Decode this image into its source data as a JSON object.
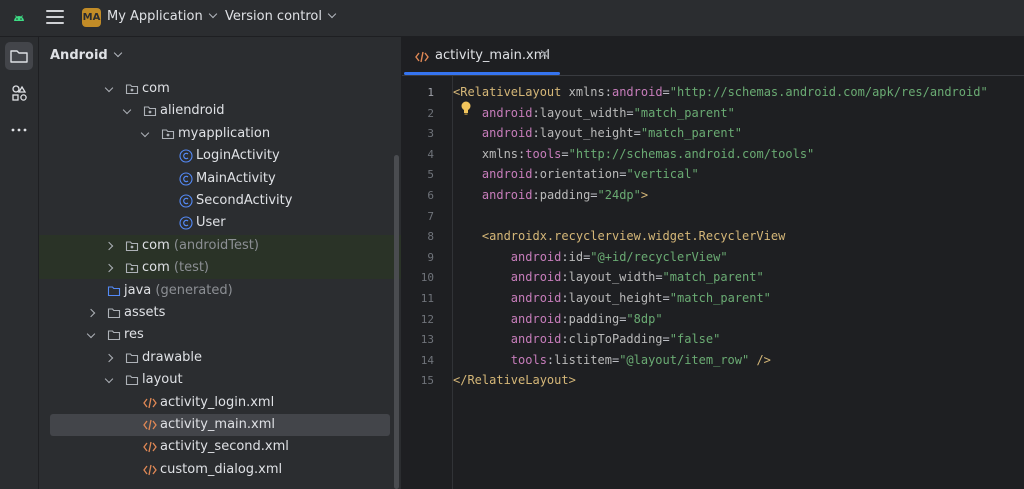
{
  "titlebar": {
    "project_badge": "MA",
    "project_name": "My Application",
    "vcs_label": "Version control"
  },
  "panel": {
    "view_label": "Android"
  },
  "tree": [
    {
      "label": "com",
      "suffix": "",
      "icon": "package-icon",
      "arrow": "down",
      "indent": 1
    },
    {
      "label": "aliendroid",
      "suffix": "",
      "icon": "package-icon",
      "arrow": "down",
      "indent": 2
    },
    {
      "label": "myapplication",
      "suffix": "",
      "icon": "package-icon",
      "arrow": "down",
      "indent": 3
    },
    {
      "label": "LoginActivity",
      "suffix": "",
      "icon": "class-icon",
      "arrow": "",
      "indent": 4
    },
    {
      "label": "MainActivity",
      "suffix": "",
      "icon": "class-icon",
      "arrow": "",
      "indent": 4
    },
    {
      "label": "SecondActivity",
      "suffix": "",
      "icon": "class-icon",
      "arrow": "",
      "indent": 4
    },
    {
      "label": "User",
      "suffix": "",
      "icon": "class-icon",
      "arrow": "",
      "indent": 4
    },
    {
      "label": "com",
      "suffix": "(androidTest)",
      "icon": "package-icon",
      "arrow": "right",
      "indent": 1,
      "highlight": "green"
    },
    {
      "label": "com",
      "suffix": "(test)",
      "icon": "package-icon",
      "arrow": "right",
      "indent": 1,
      "highlight": "green"
    },
    {
      "label": "java",
      "suffix": "(generated)",
      "icon": "generated-folder-icon",
      "arrow": "",
      "indent": 0
    },
    {
      "label": "assets",
      "suffix": "",
      "icon": "folder-icon",
      "arrow": "right",
      "indent": 0
    },
    {
      "label": "res",
      "suffix": "",
      "icon": "folder-icon",
      "arrow": "down",
      "indent": 0
    },
    {
      "label": "drawable",
      "suffix": "",
      "icon": "folder-icon",
      "arrow": "right",
      "indent": 1
    },
    {
      "label": "layout",
      "suffix": "",
      "icon": "folder-icon",
      "arrow": "down",
      "indent": 1
    },
    {
      "label": "activity_login.xml",
      "suffix": "",
      "icon": "xml-file-icon",
      "arrow": "",
      "indent": 2
    },
    {
      "label": "activity_main.xml",
      "suffix": "",
      "icon": "xml-file-icon",
      "arrow": "",
      "indent": 2,
      "selected": true
    },
    {
      "label": "activity_second.xml",
      "suffix": "",
      "icon": "xml-file-icon",
      "arrow": "",
      "indent": 2
    },
    {
      "label": "custom_dialog.xml",
      "suffix": "",
      "icon": "xml-file-icon",
      "arrow": "",
      "indent": 2
    }
  ],
  "editor": {
    "tab_label": "activity_main.xml",
    "tab_close": "×",
    "lines": [
      [
        [
          "t-br",
          "<"
        ],
        [
          "t-tag",
          "RelativeLayout "
        ],
        [
          "t-attr",
          "xmlns"
        ],
        [
          "t-eq",
          ":"
        ],
        [
          "t-ns",
          "android"
        ],
        [
          "t-eq",
          "="
        ],
        [
          "t-val",
          "\"http://schemas.android.com/apk/res/android\""
        ]
      ],
      [
        [
          "t-ns",
          "    android"
        ],
        [
          "t-eq",
          ":"
        ],
        [
          "t-attr",
          "layout_width"
        ],
        [
          "t-eq",
          "="
        ],
        [
          "t-val",
          "\"match_parent\""
        ]
      ],
      [
        [
          "t-ns",
          "    android"
        ],
        [
          "t-eq",
          ":"
        ],
        [
          "t-attr",
          "layout_height"
        ],
        [
          "t-eq",
          "="
        ],
        [
          "t-val",
          "\"match_parent\""
        ]
      ],
      [
        [
          "t-attr",
          "    xmlns"
        ],
        [
          "t-eq",
          ":"
        ],
        [
          "t-ns",
          "tools"
        ],
        [
          "t-eq",
          "="
        ],
        [
          "t-val",
          "\"http://schemas.android.com/tools\""
        ]
      ],
      [
        [
          "t-ns",
          "    android"
        ],
        [
          "t-eq",
          ":"
        ],
        [
          "t-attr",
          "orientation"
        ],
        [
          "t-eq",
          "="
        ],
        [
          "t-val",
          "\"vertical\""
        ]
      ],
      [
        [
          "t-ns",
          "    android"
        ],
        [
          "t-eq",
          ":"
        ],
        [
          "t-attr",
          "padding"
        ],
        [
          "t-eq",
          "="
        ],
        [
          "t-val",
          "\"24dp\""
        ],
        [
          "t-br",
          ">"
        ]
      ],
      [],
      [
        [
          "t-br",
          "    <"
        ],
        [
          "t-tag",
          "androidx.recyclerview.widget.RecyclerView"
        ]
      ],
      [
        [
          "t-ns",
          "        android"
        ],
        [
          "t-eq",
          ":"
        ],
        [
          "t-attr",
          "id"
        ],
        [
          "t-eq",
          "="
        ],
        [
          "t-val",
          "\"@+id/recyclerView\""
        ]
      ],
      [
        [
          "t-ns",
          "        android"
        ],
        [
          "t-eq",
          ":"
        ],
        [
          "t-attr",
          "layout_width"
        ],
        [
          "t-eq",
          "="
        ],
        [
          "t-val",
          "\"match_parent\""
        ]
      ],
      [
        [
          "t-ns",
          "        android"
        ],
        [
          "t-eq",
          ":"
        ],
        [
          "t-attr",
          "layout_height"
        ],
        [
          "t-eq",
          "="
        ],
        [
          "t-val",
          "\"match_parent\""
        ]
      ],
      [
        [
          "t-ns",
          "        android"
        ],
        [
          "t-eq",
          ":"
        ],
        [
          "t-attr",
          "padding"
        ],
        [
          "t-eq",
          "="
        ],
        [
          "t-val",
          "\"8dp\""
        ]
      ],
      [
        [
          "t-ns",
          "        android"
        ],
        [
          "t-eq",
          ":"
        ],
        [
          "t-attr",
          "clipToPadding"
        ],
        [
          "t-eq",
          "="
        ],
        [
          "t-val",
          "\"false\""
        ]
      ],
      [
        [
          "t-ns",
          "        tools"
        ],
        [
          "t-eq",
          ":"
        ],
        [
          "t-attr",
          "listitem"
        ],
        [
          "t-eq",
          "="
        ],
        [
          "t-val",
          "\"@layout/item_row\""
        ],
        [
          "t-br",
          " />"
        ]
      ],
      [
        [
          "t-br",
          "</"
        ],
        [
          "t-tag",
          "RelativeLayout"
        ],
        [
          "t-br",
          ">"
        ]
      ]
    ]
  }
}
